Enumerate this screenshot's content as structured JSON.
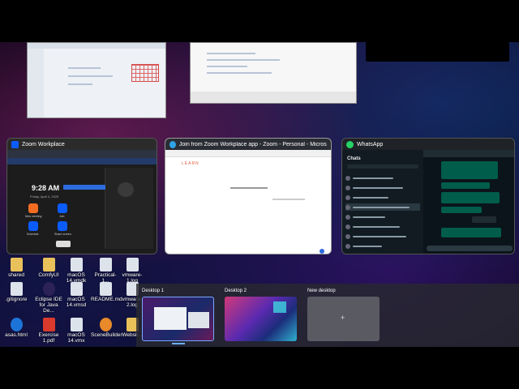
{
  "windows": {
    "zoom": {
      "title": "Zoom Workplace",
      "clock": "9:28 AM",
      "date": "Friday, April 4, 2025",
      "actions": [
        "New meeting",
        "Join",
        "Schedule",
        "Share screen"
      ],
      "icon": "zoom-icon",
      "accent": "#0b5cff"
    },
    "edge": {
      "title": "Join from Zoom Workplace app - Zoom - Personal - Microsoft Edge",
      "brand_text": "LEARN",
      "icon": "edge-icon"
    },
    "whatsapp": {
      "title": "WhatsApp",
      "side_header": "Chats",
      "icon": "whatsapp-icon",
      "accent": "#25d366"
    }
  },
  "desktop_icons": {
    "row1": [
      "shared",
      "ComfyUI",
      "macOS 14.vmdk",
      "Practical-1...",
      "vmware-1.log"
    ],
    "row2": [
      ".gitignore",
      "Eclipse IDE for Java De...",
      "macOS 14.vmsd",
      "README.md",
      "vmware-2.log"
    ],
    "row3": [
      "asas.html",
      "Exercise 1.pdf",
      "macOS 14.vmx",
      "SceneBuilder",
      "Websit..."
    ]
  },
  "desktops": {
    "items": [
      {
        "label": "Desktop 1"
      },
      {
        "label": "Desktop 2"
      },
      {
        "label": "New desktop"
      }
    ],
    "new_symbol": "+"
  }
}
